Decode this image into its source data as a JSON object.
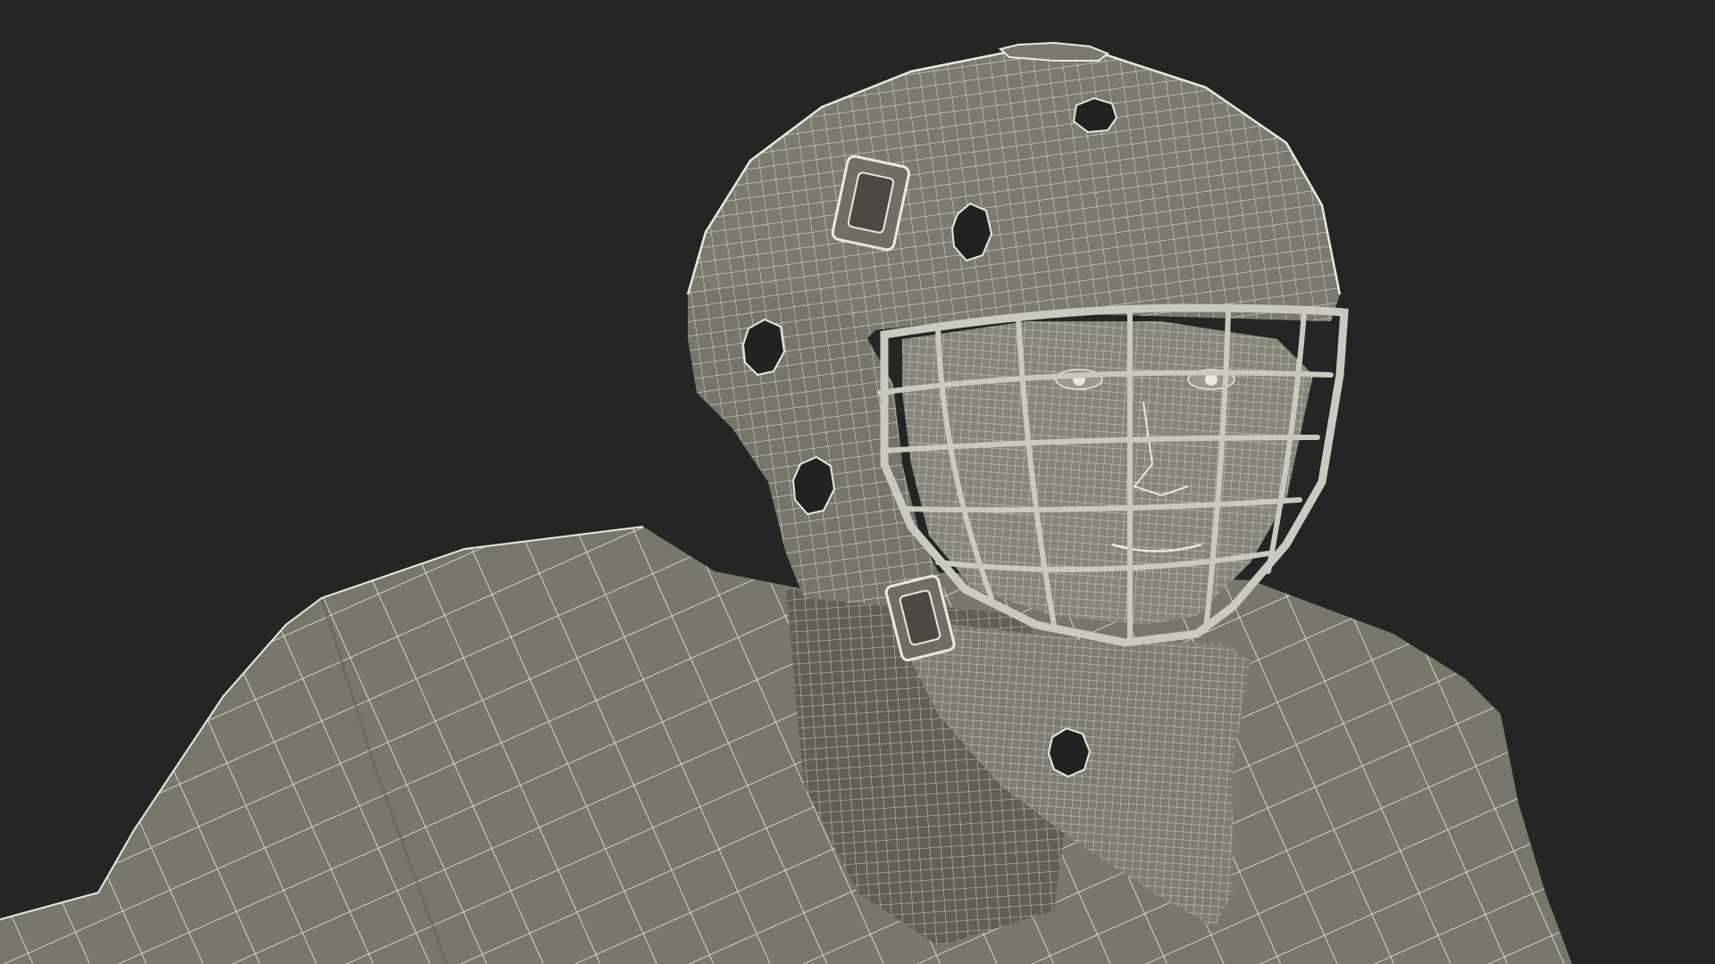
{
  "scene": {
    "subject": "hockey-goalie-wireframe-render",
    "colors": {
      "background": "#252525",
      "surface": "#77776c",
      "surface_dark": "#606056",
      "surface_light": "#8a8a7e",
      "wire": "#e9e9dd",
      "cage": "#c9c9bd",
      "hole": "#222222"
    }
  }
}
